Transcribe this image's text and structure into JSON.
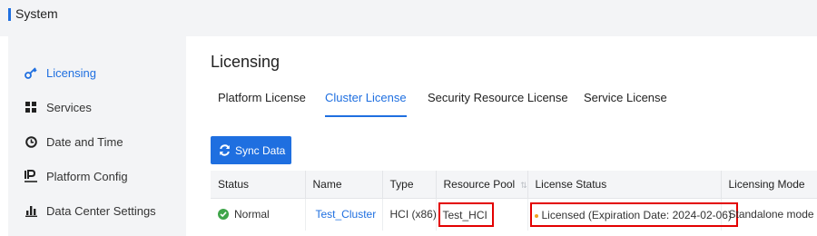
{
  "topbar": {
    "title": "System"
  },
  "sidebar": {
    "items": [
      {
        "label": "Licensing",
        "icon": "key-icon",
        "active": true
      },
      {
        "label": "Services",
        "icon": "grid-icon"
      },
      {
        "label": "Date and Time",
        "icon": "clock-icon"
      },
      {
        "label": "Platform Config",
        "icon": "ip-icon"
      },
      {
        "label": "Data Center Settings",
        "icon": "bar-chart-icon"
      }
    ]
  },
  "main": {
    "title": "Licensing",
    "tabs": [
      {
        "label": "Platform License"
      },
      {
        "label": "Cluster License",
        "active": true
      },
      {
        "label": "Security Resource License"
      },
      {
        "label": "Service License"
      }
    ],
    "sync_button": "Sync Data",
    "table": {
      "headers": [
        "Status",
        "Name",
        "Type",
        "Resource Pool",
        "License Status",
        "Licensing Mode"
      ],
      "rows": [
        {
          "status": "Normal",
          "name": "Test_Cluster",
          "type": "HCI (x86)",
          "resource_pool": "Test_HCI",
          "license_status": "Licensed (Expiration Date:  2024-02-06)",
          "licensing_mode": "Standalone mode"
        }
      ]
    }
  },
  "colors": {
    "accent": "#1f6fe0",
    "status_ok": "#3fa54a",
    "highlight_box": "#e30000"
  }
}
